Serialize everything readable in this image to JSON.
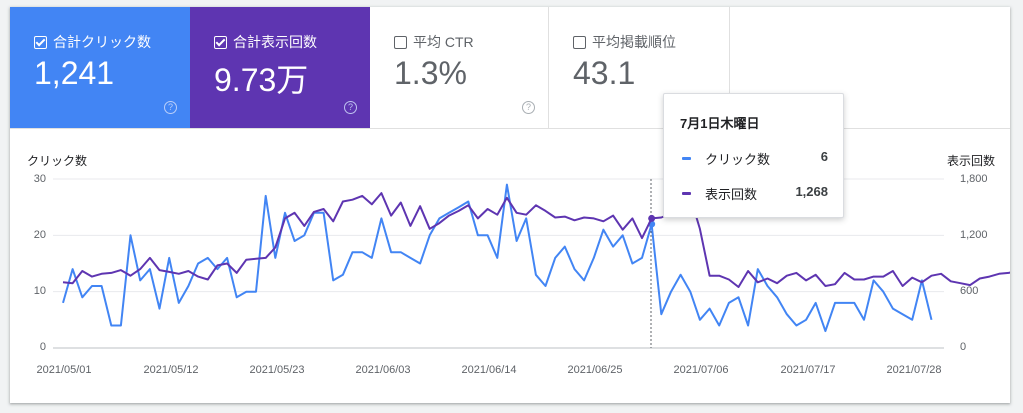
{
  "metrics": [
    {
      "label": "合計クリック数",
      "value": "1,241",
      "checked": true,
      "color": "#4285f4",
      "help": "?"
    },
    {
      "label": "合計表示回数",
      "value": "9.73万",
      "checked": true,
      "color": "#5e35b1",
      "help": "?"
    },
    {
      "label": "平均 CTR",
      "value": "1.3%",
      "checked": false,
      "help": "?"
    },
    {
      "label": "平均掲載順位",
      "value": "43.1",
      "checked": false
    }
  ],
  "tooltip": {
    "date": "7月1日木曜日",
    "rows": [
      {
        "label": "クリック数",
        "value": "6",
        "color": "#4285f4"
      },
      {
        "label": "表示回数",
        "value": "1,268",
        "color": "#5e35b1"
      }
    ]
  },
  "chart_data": {
    "type": "line",
    "ylabel": "クリック数",
    "y2label": "表示回数",
    "ylim": [
      0,
      30
    ],
    "y2lim": [
      0,
      1800
    ],
    "yticks": [
      "0",
      "10",
      "20",
      "30"
    ],
    "y2ticks": [
      "0",
      "600",
      "1,200",
      "1,800"
    ],
    "xtick_labels": [
      "2021/05/01",
      "2021/05/12",
      "2021/05/23",
      "2021/06/03",
      "2021/06/14",
      "2021/06/25",
      "2021/07/06",
      "2021/07/17",
      "2021/07/28"
    ],
    "x_start": "2021/05/01",
    "highlight": "2021/07/01",
    "grid": true,
    "series": [
      {
        "name": "クリック数",
        "axis": "left",
        "color": "#4285f4",
        "values": [
          8,
          14,
          9,
          11,
          11,
          4,
          4,
          20,
          12,
          14,
          7,
          16,
          8,
          11,
          15,
          16,
          14,
          16,
          9,
          10,
          10,
          27,
          16,
          24,
          19,
          20,
          24,
          24,
          12,
          13,
          17,
          17,
          16,
          23,
          17,
          17,
          16,
          15,
          20,
          23,
          24,
          25,
          26,
          20,
          20,
          16,
          29,
          19,
          23,
          13,
          11,
          16,
          18,
          14,
          12,
          16,
          21,
          18,
          20,
          15,
          16,
          22,
          6,
          10,
          13,
          10,
          5,
          7,
          4,
          8,
          9,
          4,
          14,
          11,
          9,
          6,
          4,
          5,
          8,
          3,
          8,
          8,
          8,
          5,
          12,
          10,
          7,
          6,
          5,
          12,
          5
        ]
      },
      {
        "name": "表示回数",
        "axis": "right",
        "color": "#5e35b1",
        "values": [
          700,
          690,
          820,
          760,
          790,
          800,
          830,
          770,
          840,
          960,
          830,
          810,
          790,
          820,
          760,
          730,
          880,
          900,
          800,
          940,
          950,
          960,
          1070,
          1380,
          1440,
          1300,
          1450,
          1480,
          1350,
          1560,
          1580,
          1620,
          1530,
          1650,
          1410,
          1550,
          1300,
          1510,
          1270,
          1330,
          1410,
          1460,
          1520,
          1380,
          1480,
          1420,
          1600,
          1440,
          1420,
          1520,
          1460,
          1390,
          1400,
          1360,
          1390,
          1380,
          1350,
          1410,
          1260,
          1380,
          1170,
          1380,
          1390,
          1430,
          1410,
          1610,
          1268,
          770,
          770,
          730,
          650,
          820,
          700,
          740,
          690,
          770,
          800,
          720,
          780,
          660,
          680,
          800,
          730,
          730,
          760,
          760,
          820,
          660,
          750,
          700,
          770,
          790,
          710,
          690,
          670,
          740,
          760,
          790,
          800,
          830,
          1000,
          1010
        ]
      }
    ]
  }
}
